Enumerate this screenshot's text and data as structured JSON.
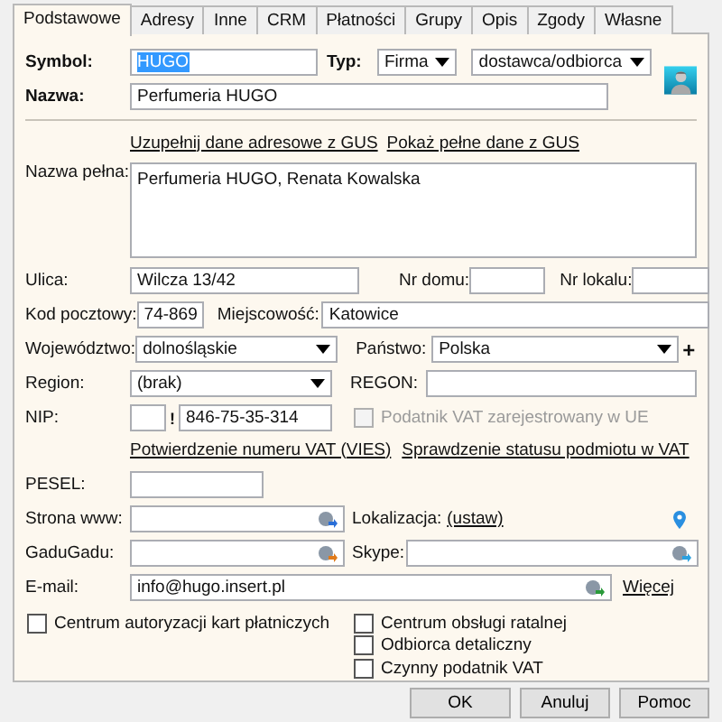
{
  "tabs": [
    {
      "label": "Podstawowe",
      "selected": true
    },
    {
      "label": "Adresy",
      "selected": false
    },
    {
      "label": "Inne",
      "selected": false
    },
    {
      "label": "CRM",
      "selected": false
    },
    {
      "label": "Płatności",
      "selected": false
    },
    {
      "label": "Grupy",
      "selected": false
    },
    {
      "label": "Opis",
      "selected": false
    },
    {
      "label": "Zgody",
      "selected": false
    },
    {
      "label": "Własne",
      "selected": false
    }
  ],
  "symbol": {
    "label": "Symbol:",
    "value": "HUGO",
    "text_selected": true
  },
  "typ": {
    "label": "Typ:",
    "value": "Firma",
    "role": "dostawca/odbiorca"
  },
  "nazwa": {
    "label": "Nazwa:",
    "value": "Perfumeria HUGO"
  },
  "gus_links": [
    "Uzupełnij dane adresowe z GUS",
    "Pokaż pełne dane z GUS"
  ],
  "nazwa_pelna": {
    "label": "Nazwa pełna:",
    "value": "Perfumeria HUGO, Renata Kowalska"
  },
  "ulica": {
    "label": "Ulica:",
    "value": "Wilcza  13/42"
  },
  "nr_domu": {
    "label": "Nr domu:"
  },
  "nr_lokalu": {
    "label": "Nr lokalu:"
  },
  "kod": {
    "label": "Kod pocztowy:",
    "value": "74-869"
  },
  "miejscowosc": {
    "label": "Miejscowość:",
    "value": "Katowice"
  },
  "wojewodztwo": {
    "label": "Województwo:",
    "value": "dolnośląskie"
  },
  "panstwo": {
    "label": "Państwo:",
    "value": "Polska",
    "add": "+"
  },
  "region": {
    "label": "Region:",
    "value": "(brak)"
  },
  "regon": {
    "label": "REGON:"
  },
  "nip": {
    "label": "NIP:",
    "flag": "!",
    "value": "846-75-35-314"
  },
  "vat_ue": {
    "label": "Podatnik VAT zarejestrowany w UE",
    "checked": false,
    "disabled": true
  },
  "vat_links": [
    "Potwierdzenie numeru VAT (VIES)",
    "Sprawdzenie statusu podmiotu w VAT"
  ],
  "pesel": {
    "label": "PESEL:"
  },
  "www": {
    "label": "Strona www:"
  },
  "lokalizacja": {
    "label": "Lokalizacja:",
    "link": "(ustaw)"
  },
  "gadugadu": {
    "label": "GaduGadu:"
  },
  "skype": {
    "label": "Skype:"
  },
  "email": {
    "label": "E-mail:",
    "value": "info@hugo.insert.pl",
    "more": "Więcej"
  },
  "checkboxes_left": [
    {
      "label": "Centrum autoryzacji kart płatniczych",
      "checked": false
    }
  ],
  "checkboxes_right": [
    {
      "label": "Centrum obsługi ratalnej",
      "checked": false
    },
    {
      "label": "Odbiorca detaliczny",
      "checked": false
    },
    {
      "label": "Czynny podatnik VAT",
      "checked": false
    }
  ],
  "buttons": [
    "OK",
    "Anuluj",
    "Pomoc"
  ]
}
